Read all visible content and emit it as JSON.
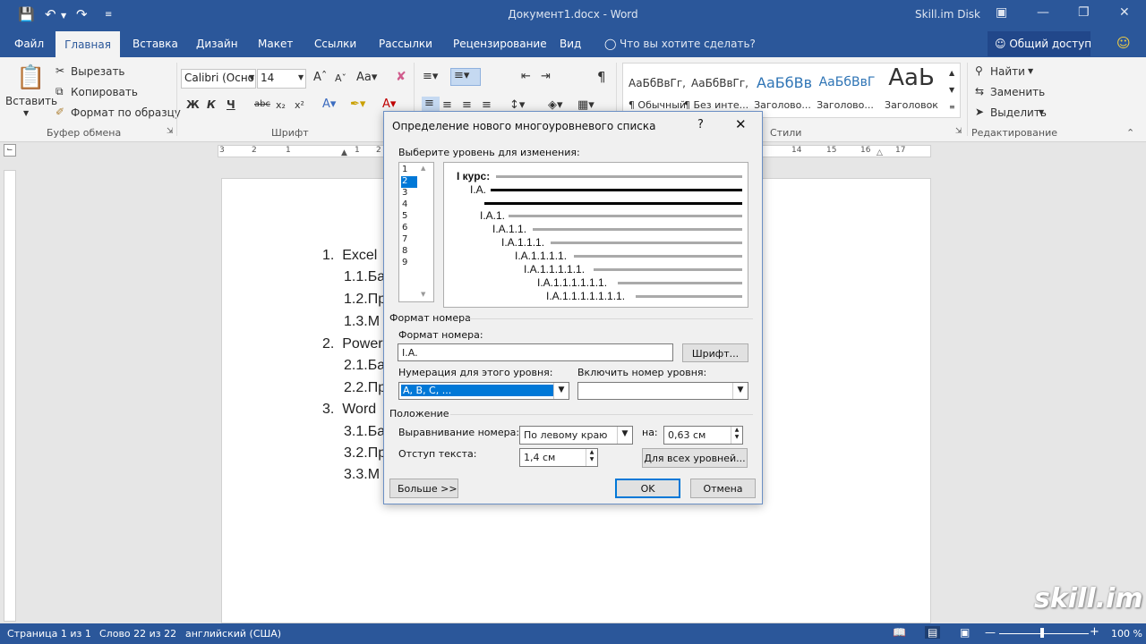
{
  "titlebar": {
    "doc_title": "Документ1.docx - Word",
    "skill_disk": "Skill.im Disk"
  },
  "tabs": {
    "file": "Файл",
    "home": "Главная",
    "insert": "Вставка",
    "design": "Дизайн",
    "layout": "Макет",
    "references": "Ссылки",
    "mailings": "Рассылки",
    "review": "Рецензирование",
    "view": "Вид",
    "tell_me": "Что вы хотите сделать?",
    "share": "Общий доступ"
  },
  "ribbon": {
    "paste": "Вставить",
    "cut": "Вырезать",
    "copy": "Копировать",
    "format_painter": "Формат по образцу",
    "clipboard_group": "Буфер обмена",
    "font_name": "Calibri (Осно",
    "font_size": "14",
    "font_group": "Шрифт",
    "styles": [
      {
        "sample": "АаБбВвГг,",
        "name": "¶ Обычный"
      },
      {
        "sample": "АаБбВвГг,",
        "name": "¶ Без инте..."
      },
      {
        "sample": "АаБбВв",
        "name": "Заголово..."
      },
      {
        "sample": "АаБбВвГ",
        "name": "Заголово..."
      },
      {
        "sample": "АаЬ",
        "name": "Заголовок"
      }
    ],
    "styles_group": "Стили",
    "find": "Найти",
    "replace": "Заменить",
    "select": "Выделить",
    "editing_group": "Редактирование"
  },
  "ruler": {
    "left_ticks": [
      "3",
      "2",
      "1",
      "1",
      "2"
    ],
    "right_ticks": [
      "14",
      "15",
      "16",
      "17"
    ]
  },
  "document": {
    "items": [
      {
        "num": "1.",
        "text": "Excel"
      },
      {
        "num": "",
        "text": "1.1.Ба"
      },
      {
        "num": "",
        "text": "1.2.Пр"
      },
      {
        "num": "",
        "text": "1.3.М"
      },
      {
        "num": "2.",
        "text": "Power"
      },
      {
        "num": "",
        "text": "2.1.Ба"
      },
      {
        "num": "",
        "text": "2.2.Пр"
      },
      {
        "num": "3.",
        "text": "Word"
      },
      {
        "num": "",
        "text": "3.1.Ба"
      },
      {
        "num": "",
        "text": "3.2.Пр"
      },
      {
        "num": "",
        "text": "3.3.М"
      }
    ]
  },
  "dialog": {
    "title": "Определение нового многоуровневого списка",
    "help": "?",
    "level_label": "Выберите уровень для изменения:",
    "levels": [
      "1",
      "2",
      "3",
      "4",
      "5",
      "6",
      "7",
      "8",
      "9"
    ],
    "selected_level": "2",
    "preview": [
      "I курс:",
      "I.A.",
      "I.A.1.",
      "I.A.1.1.",
      "I.A.1.1.1.",
      "I.A.1.1.1.1.",
      "I.A.1.1.1.1.1.",
      "I.A.1.1.1.1.1.1.",
      "I.A.1.1.1.1.1.1.1."
    ],
    "number_format_section": "Формат номера",
    "number_format_label": "Формат номера:",
    "number_format_value": "I.A.",
    "font_button": "Шрифт...",
    "numbering_style_label": "Нумерация для этого уровня:",
    "numbering_style_value": "A, B, C, ...",
    "include_level_label": "Включить номер уровня:",
    "include_level_value": "",
    "position_section": "Положение",
    "alignment_label": "Выравнивание номера:",
    "alignment_value": "По левому краю",
    "at_label": "на:",
    "at_value": "0,63 см",
    "indent_label": "Отступ текста:",
    "indent_value": "1,4 см",
    "all_levels_button": "Для всех уровней...",
    "more_button": "Больше >>",
    "ok_button": "OK",
    "cancel_button": "Отмена"
  },
  "statusbar": {
    "page": "Страница 1 из 1",
    "words": "Слово 22 из 22",
    "language": "английский (США)",
    "zoom": "100 %"
  },
  "watermark": "skill.im"
}
